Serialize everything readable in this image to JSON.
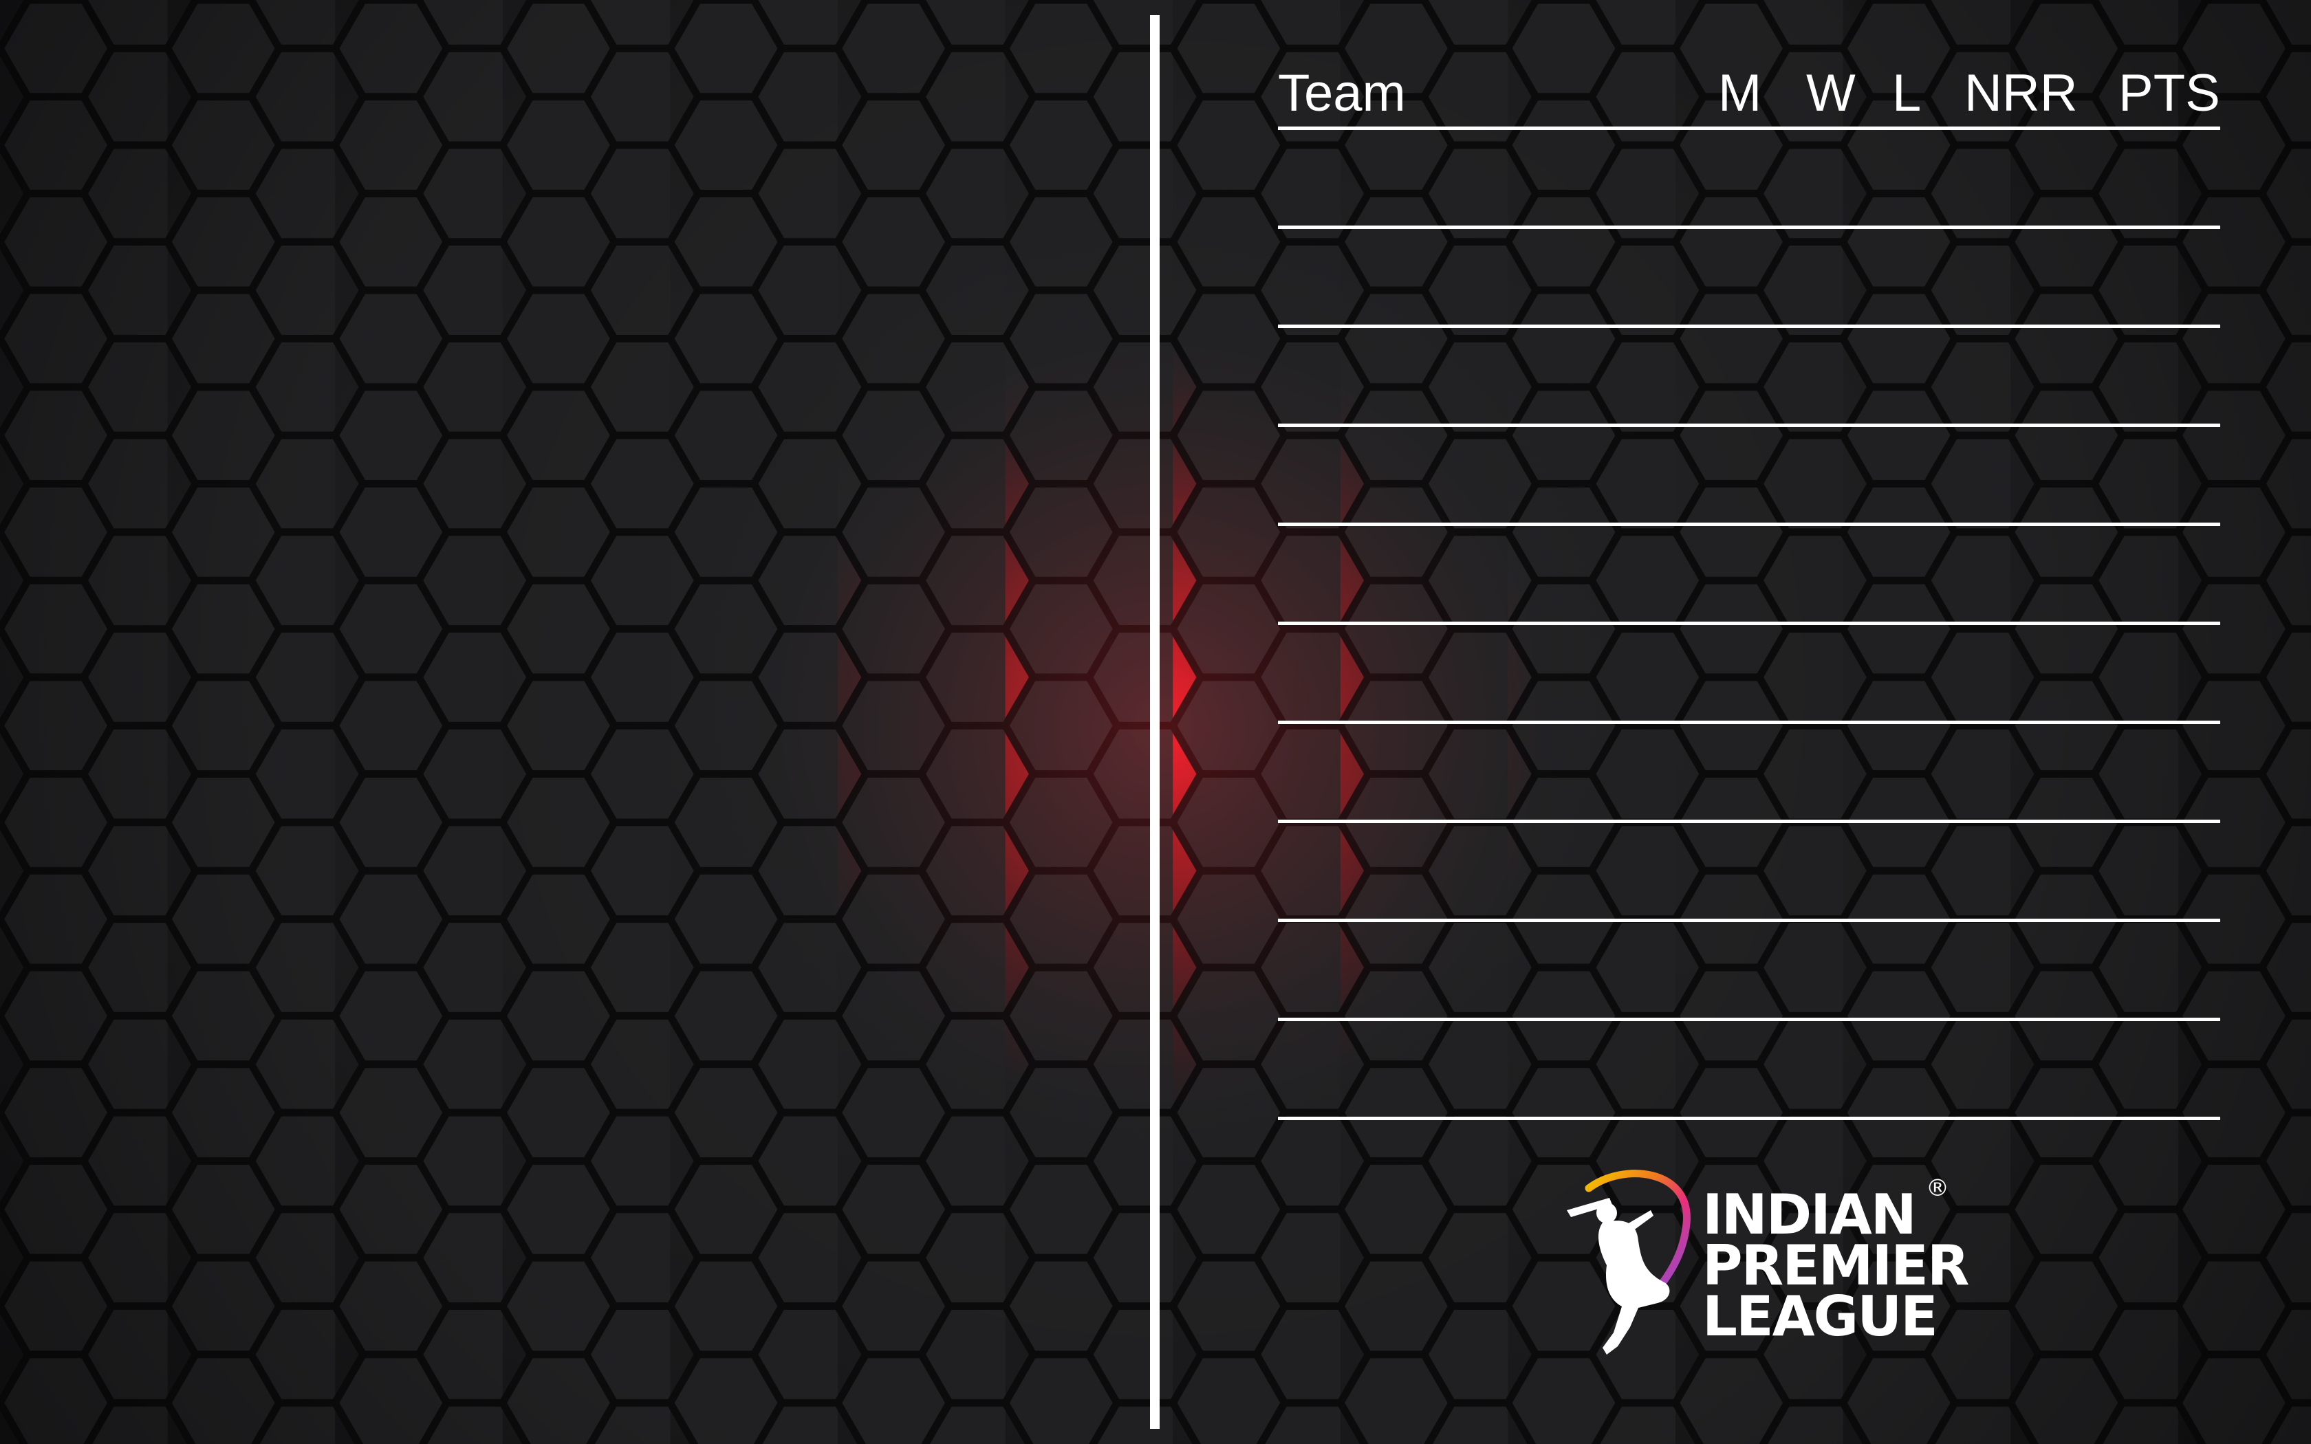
{
  "table": {
    "headers": {
      "team": "Team",
      "matches": "M",
      "wins": "W",
      "losses": "L",
      "nrr": "NRR",
      "points": "PTS"
    },
    "rows": [
      "",
      "",
      "",
      "",
      "",
      "",
      "",
      "",
      "",
      ""
    ]
  },
  "logo": {
    "line1": "INDIAN",
    "line2": "PREMIER",
    "line3": "LEAGUE",
    "registered": "®"
  },
  "colors": {
    "background": "#1c1c1e",
    "glow": "#d4141c",
    "foreground": "#ffffff"
  },
  "icons": {
    "logo_mark": "batsman-icon"
  }
}
